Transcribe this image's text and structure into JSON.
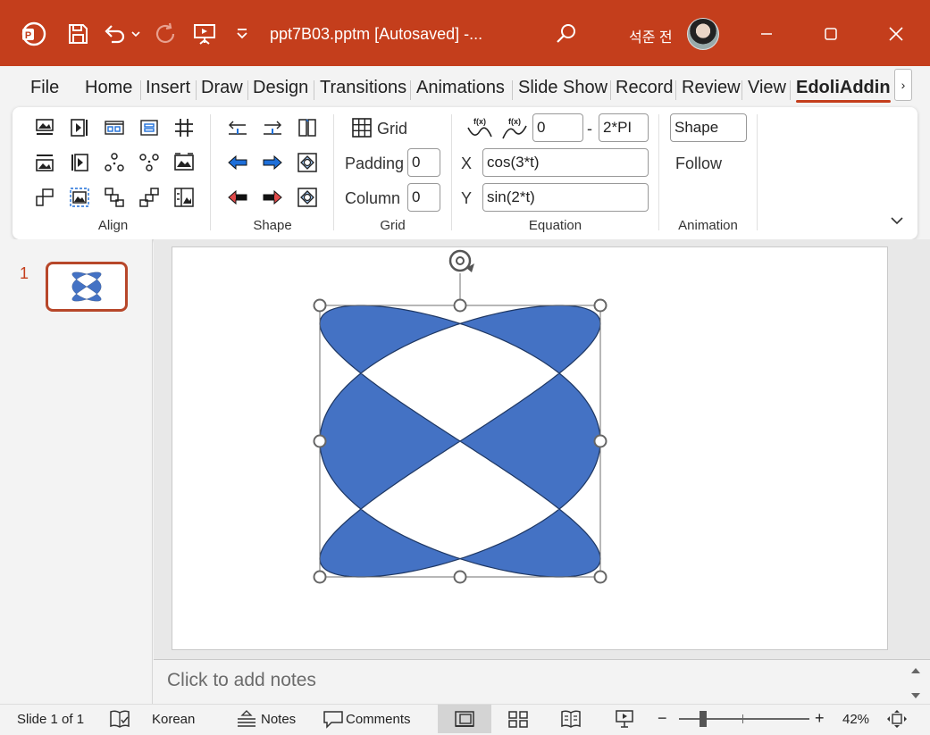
{
  "titlebar": {
    "doc_title": "ppt7B03.pptm [Autosaved]  -...",
    "user_name": "석준 전",
    "bg_color": "#c43e1c"
  },
  "tabs": [
    {
      "label": "File"
    },
    {
      "label": "Home"
    },
    {
      "label": "Insert"
    },
    {
      "label": "Draw"
    },
    {
      "label": "Design"
    },
    {
      "label": "Transitions"
    },
    {
      "label": "Animations"
    },
    {
      "label": "Slide Show"
    },
    {
      "label": "Record"
    },
    {
      "label": "Review"
    },
    {
      "label": "View"
    },
    {
      "label": "EdoliAddin"
    }
  ],
  "ribbon": {
    "groups": {
      "align": "Align",
      "shape": "Shape",
      "grid": "Grid",
      "equation": "Equation",
      "animation": "Animation"
    },
    "grid": {
      "grid_label": "Grid",
      "padding_label": "Padding",
      "padding_value": "0",
      "column_label": "Column",
      "column_value": "0"
    },
    "equation": {
      "fx_label": "f(x)",
      "t_start": "0",
      "range_sep": "-",
      "t_end": "2*PI",
      "x_label": "X",
      "x_expr": "cos(3*t)",
      "y_label": "Y",
      "y_expr": "sin(2*t)"
    },
    "animation": {
      "shape_value": "Shape",
      "follow_label": "Follow"
    }
  },
  "thumbnails": [
    {
      "number": "1"
    }
  ],
  "notes": {
    "placeholder": "Click to add notes"
  },
  "status": {
    "slide_info": "Slide 1 of 1",
    "language": "Korean",
    "notes_label": "Notes",
    "comments_label": "Comments",
    "zoom": "42%",
    "zoom_percent": 42
  },
  "shape": {
    "fill_color": "#4472c4",
    "stroke_color": "#1f3864"
  }
}
